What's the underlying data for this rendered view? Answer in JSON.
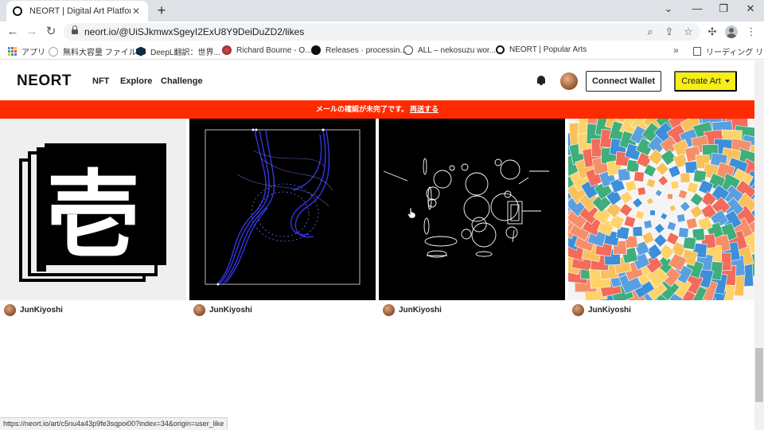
{
  "browser": {
    "tab_title": "NEORT | Digital Art Platform",
    "url": "neort.io/@UiSJkmwxSgeyI2ExU8Y9DeiDuZD2/likes",
    "bookmarks": [
      {
        "label": "アプリ",
        "icon": "apps-icon"
      },
      {
        "label": "無料大容量 ファイル...",
        "icon": "file-icon"
      },
      {
        "label": "DeepL翻訳：世界...",
        "icon": "deepl-icon"
      },
      {
        "label": "Richard Bourne - O...",
        "icon": "globe-icon"
      },
      {
        "label": "Releases · processin...",
        "icon": "github-icon"
      },
      {
        "label": "ALL – nekosuzu wor...",
        "icon": "wordpress-icon"
      },
      {
        "label": "NEORT | Popular Arts",
        "icon": "neort-icon"
      }
    ],
    "reading_list": "リーディング リスト",
    "status_url": "https://neort.io/art/c5nu4a43p9fe3sqpoi00?index=34&origin=user_like"
  },
  "site": {
    "logo": "NEORT",
    "nav": [
      "NFT",
      "Explore",
      "Challenge"
    ],
    "connect_wallet": "Connect Wallet",
    "create_art": "Create Art",
    "banner_text": "メールの確認が未完了です。",
    "banner_link": "再送する"
  },
  "artworks": [
    {
      "author": "JunKiyoshi",
      "kanji": "壱"
    },
    {
      "author": "JunKiyoshi"
    },
    {
      "author": "JunKiyoshi"
    },
    {
      "author": "JunKiyoshi"
    }
  ],
  "colors": {
    "banner": "#ff2a00",
    "create_art": "#f7ed17"
  }
}
